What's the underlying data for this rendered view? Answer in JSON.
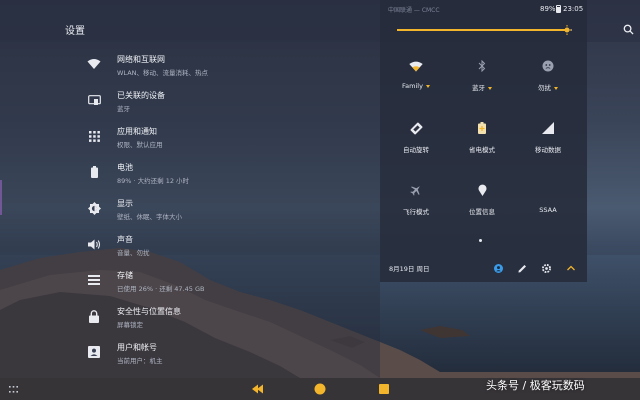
{
  "header": {
    "title": "设置"
  },
  "settings": [
    {
      "title": "网络和互联网",
      "subtitle": "WLAN、移动、流量消耗、热点",
      "icon": "wifi-icon"
    },
    {
      "title": "已关联的设备",
      "subtitle": "蓝牙",
      "icon": "devices-icon"
    },
    {
      "title": "应用和通知",
      "subtitle": "权限、默认应用",
      "icon": "apps-icon"
    },
    {
      "title": "电池",
      "subtitle": "89% · 大约还剩 12 小时",
      "icon": "battery-icon"
    },
    {
      "title": "显示",
      "subtitle": "壁纸、休眠、字体大小",
      "icon": "brightness-icon"
    },
    {
      "title": "声音",
      "subtitle": "音量、勿扰",
      "icon": "volume-icon"
    },
    {
      "title": "存储",
      "subtitle": "已使用 26% · 还剩 47.45 GB",
      "icon": "storage-icon"
    },
    {
      "title": "安全性与位置信息",
      "subtitle": "屏幕锁定",
      "icon": "lock-icon"
    },
    {
      "title": "用户和帐号",
      "subtitle": "当前用户：机主",
      "icon": "account-icon"
    }
  ],
  "quick_settings": {
    "status_left": "中国联通 — CMCC",
    "battery": "89%",
    "time": "23:05",
    "brightness_level": 0.97,
    "tiles": [
      {
        "label": "Family",
        "icon": "wifi-icon",
        "has_dropdown": true
      },
      {
        "label": "蓝牙",
        "icon": "bluetooth-icon",
        "has_dropdown": true
      },
      {
        "label": "勿扰",
        "icon": "do-not-disturb-icon",
        "has_dropdown": true
      },
      {
        "label": "自动旋转",
        "icon": "auto-rotate-icon",
        "has_dropdown": false
      },
      {
        "label": "省电模式",
        "icon": "battery-saver-icon",
        "has_dropdown": false
      },
      {
        "label": "移动数据",
        "icon": "signal-icon",
        "has_dropdown": false
      },
      {
        "label": "飞行模式",
        "icon": "airplane-icon",
        "has_dropdown": false
      },
      {
        "label": "位置信息",
        "icon": "location-icon",
        "has_dropdown": false
      },
      {
        "label": "SSAA",
        "icon": "",
        "has_dropdown": false
      }
    ],
    "date": "8月19日 周日",
    "footer_icons": [
      "user-icon",
      "edit-icon",
      "gear-icon",
      "chevron-up-icon"
    ]
  },
  "nav": {
    "icons": [
      "apps-grid-icon",
      "back-icon",
      "home-icon",
      "recents-icon"
    ]
  },
  "watermark": "头条号 / 极客玩数码",
  "colors": {
    "accent": "#f3b52b",
    "account_blue": "#3a9be8"
  }
}
